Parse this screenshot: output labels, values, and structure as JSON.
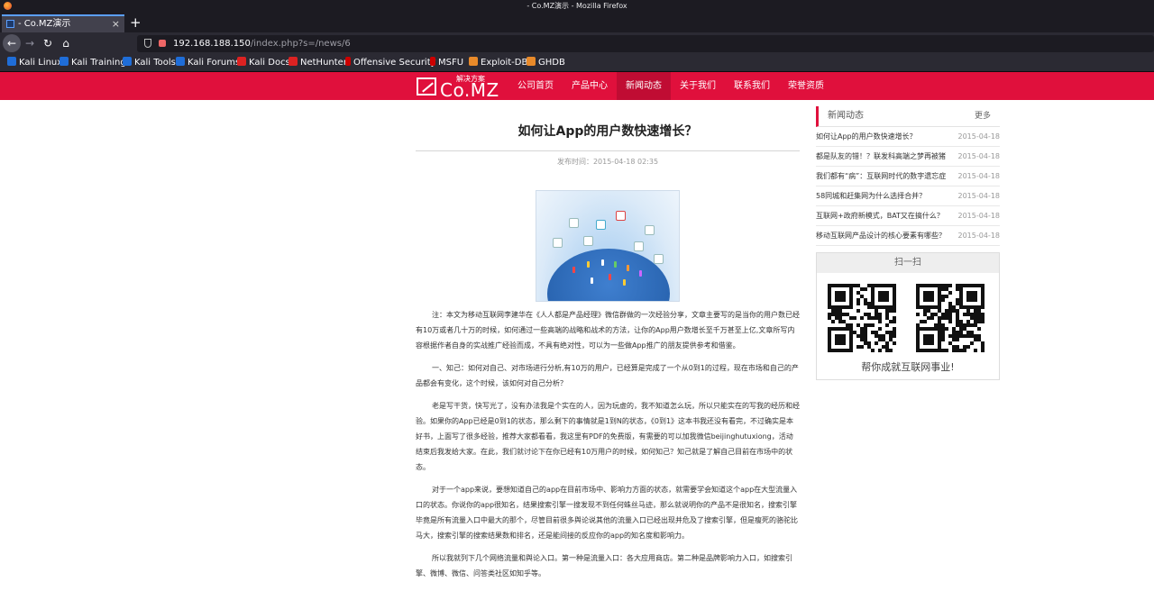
{
  "window": {
    "title": "- Co.MZ演示 - Mozilla Firefox"
  },
  "tabs": [
    {
      "label": "- Co.MZ演示",
      "close": "×"
    }
  ],
  "new_tab": "+",
  "nav": {
    "back": "←",
    "forward": "→",
    "reload": "↻",
    "home": "⌂"
  },
  "url": {
    "host": "192.168.188.150",
    "path": "/index.php?s=/news/6"
  },
  "bookmarks": [
    {
      "label": "Kali Linux",
      "color": "#1f6dd8"
    },
    {
      "label": "Kali Training",
      "color": "#1f6dd8"
    },
    {
      "label": "Kali Tools",
      "color": "#1f6dd8"
    },
    {
      "label": "Kali Forums",
      "color": "#1f6dd8"
    },
    {
      "label": "Kali Docs",
      "color": "#d22"
    },
    {
      "label": "NetHunter",
      "color": "#d22"
    },
    {
      "label": "Offensive Security",
      "color": "#c00"
    },
    {
      "label": "MSFU",
      "color": "#c00"
    },
    {
      "label": "Exploit-DB",
      "color": "#e98a2a"
    },
    {
      "label": "GHDB",
      "color": "#e98a2a"
    }
  ],
  "site": {
    "accent": "#e0103c",
    "logo": {
      "name": "Co.MZ",
      "tag": "解决方案"
    },
    "menu": [
      "公司首页",
      "产品中心",
      "新闻动态",
      "关于我们",
      "联系我们",
      "荣誉资质"
    ],
    "active_menu": "新闻动态"
  },
  "article": {
    "title": "如何让App的用户数快速增长？",
    "meta": "发布时间：2015-04-18 02:35",
    "paragraphs": [
      "注：本文为移动互联网李建华在《人人都是产品经理》微信群做的一次经验分享，文章主要写的是当你的用户数已经有10万或者几十万的时候，如何通过一些高端的战略和战术的方法，让你的App用户数增长至千万甚至上亿,文章所写内容根据作者自身的实战推广经验而成，不具有绝对性，可以为一些做App推广的朋友提供参考和借鉴。",
      "一、知己：如何对自己、对市场进行分析,有10万的用户，已经算是完成了一个从0到1的过程，现在市场和自己的产品都会有变化，这个时候，该如何对自己分析？",
      "老是写干货，快写光了，没有办法我是个实在的人，因为玩虚的，我不知道怎么玩，所以只能实在的写我的经历和经验。如果你的App已经是0到1的状态，那么剩下的事情就是1到N的状态，《0到1》这本书我还没有看完，不过确实是本好书，上面写了很多经验，推荐大家都看看，我这里有PDF的免费版，有需要的可以加我微信beijinghutuxiong，活动结束后我发给大家。在此，我们就讨论下在你已经有10万用户的时候，如何知己？知己就是了解自己目前在市场中的状态。",
      "对于一个app来说，要想知道自己的app在目前市场中、影响力方面的状态，就需要学会知道这个app在大型流量入口的状态。你说你的app很知名，结果搜索引擎一搜发现不到任何蛛丝马迹，那么就说明你的产品不是很知名，搜索引擎毕竟是所有流量入口中最大的那个，尽管目前很多舆论说其他的流量入口已经出现并危及了搜索引擎，但是瘦死的骆驼比马大，搜索引擎的搜索结果数和排名，还是能间接的反应你的app的知名度和影响力。",
      "所以我就列下几个网络流量和舆论入口。第一种是流量入口：各大应用商店。第二种是品牌影响力入口，如搜索引擎、微博、微信、问答类社区如知乎等。"
    ]
  },
  "sidebar": {
    "news_title": "新闻动态",
    "more": "更多",
    "news": [
      {
        "title": "如何让App的用户数快速增长？",
        "date": "2015-04-18"
      },
      {
        "title": "都是队友的错！？联发科高端之梦再被猪",
        "date": "2015-04-18"
      },
      {
        "title": "我们都有“病”：互联网时代的数字遗忘症",
        "date": "2015-04-18"
      },
      {
        "title": "58同城和赶集网为什么选择合并？",
        "date": "2015-04-18"
      },
      {
        "title": "互联网+政府新模式，BAT又在搞什么？",
        "date": "2015-04-18"
      },
      {
        "title": "移动互联网产品设计的核心要素有哪些？",
        "date": "2015-04-18"
      }
    ],
    "scan_title": "扫一扫",
    "scan_caption": "帮你成就互联网事业!"
  }
}
